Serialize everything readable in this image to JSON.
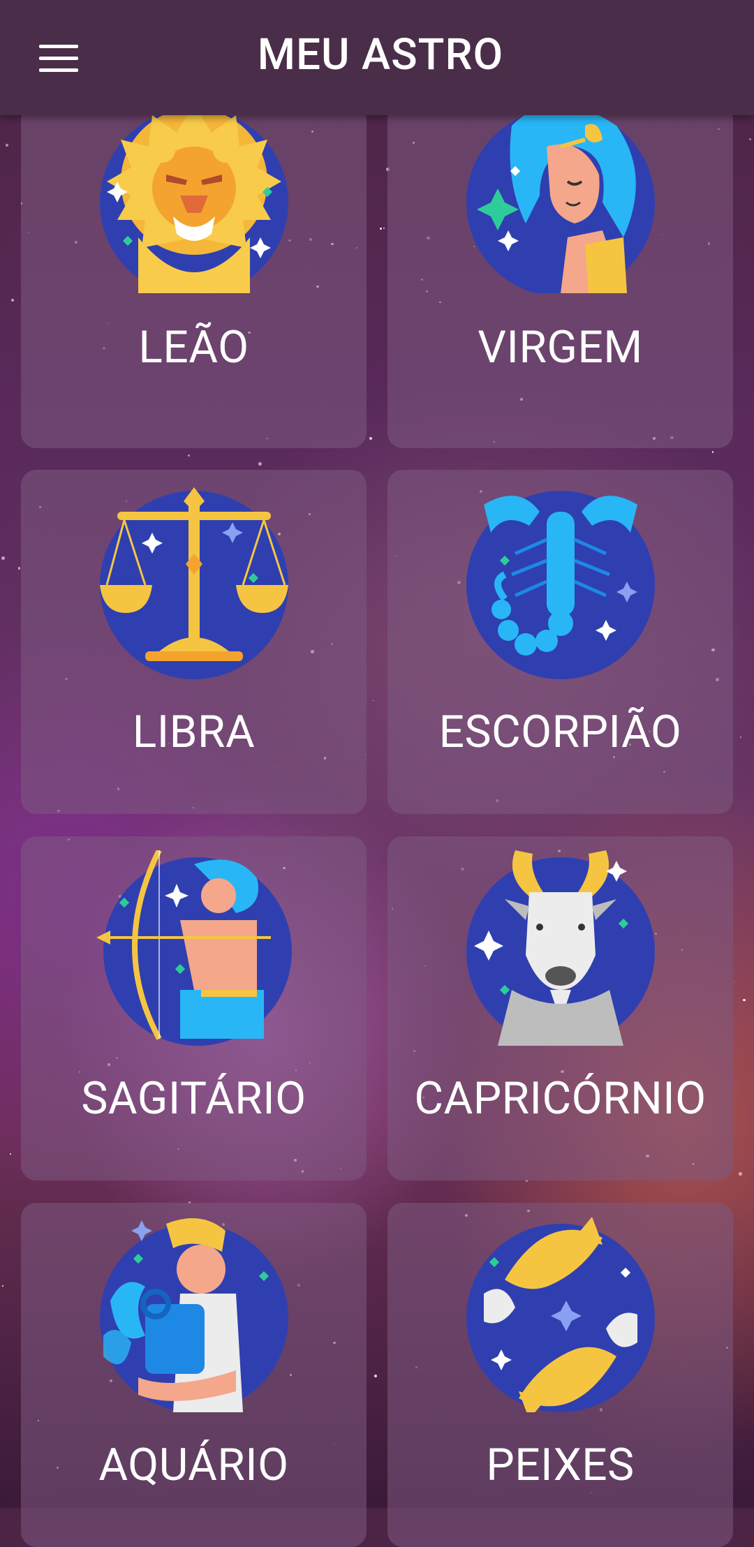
{
  "app": {
    "title": "MEU ASTRO"
  },
  "signs": [
    {
      "name": "LEÃO",
      "icon": "lion-icon"
    },
    {
      "name": "VIRGEM",
      "icon": "virgo-maiden-icon"
    },
    {
      "name": "LIBRA",
      "icon": "scales-icon"
    },
    {
      "name": "ESCORPIÃO",
      "icon": "scorpion-icon"
    },
    {
      "name": "SAGITÁRIO",
      "icon": "archer-icon"
    },
    {
      "name": "CAPRICÓRNIO",
      "icon": "goat-icon"
    },
    {
      "name": "AQUÁRIO",
      "icon": "water-bearer-icon"
    },
    {
      "name": "PEIXES",
      "icon": "fish-icon"
    }
  ],
  "colors": {
    "appbar": "#4a2d48",
    "icon_circle": "#2f3fb0",
    "accent_gold": "#f5c542",
    "accent_cyan": "#29b6f6"
  }
}
